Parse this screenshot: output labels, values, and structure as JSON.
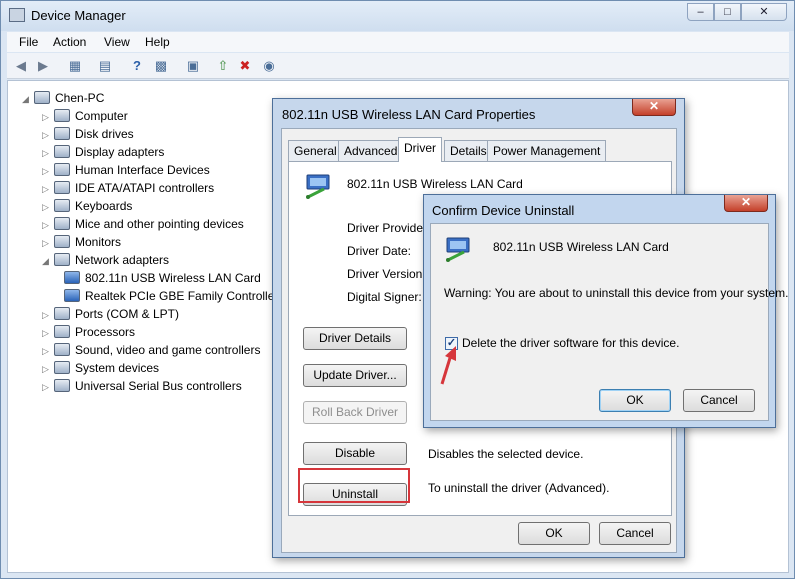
{
  "window": {
    "title": "Device Manager"
  },
  "menu": [
    "File",
    "Action",
    "View",
    "Help"
  ],
  "toolbar_icons": [
    "back-icon",
    "forward-icon",
    "show-hide-tree-icon",
    "properties-icon",
    "help-icon",
    "view-icon",
    "scan-changes-icon",
    "update-driver-icon",
    "uninstall-icon",
    "disable-icon"
  ],
  "tree": {
    "root": "Chen-PC",
    "items": [
      {
        "label": "Computer",
        "expanded": false
      },
      {
        "label": "Disk drives",
        "expanded": false
      },
      {
        "label": "Display adapters",
        "expanded": false
      },
      {
        "label": "Human Interface Devices",
        "expanded": false
      },
      {
        "label": "IDE ATA/ATAPI controllers",
        "expanded": false
      },
      {
        "label": "Keyboards",
        "expanded": false
      },
      {
        "label": "Mice and other pointing devices",
        "expanded": false
      },
      {
        "label": "Monitors",
        "expanded": false
      },
      {
        "label": "Network adapters",
        "expanded": true
      },
      {
        "label": "802.11n USB Wireless LAN Card",
        "child": true
      },
      {
        "label": "Realtek PCIe GBE Family Controlle",
        "child": true
      },
      {
        "label": "Ports (COM & LPT)",
        "expanded": false
      },
      {
        "label": "Processors",
        "expanded": false
      },
      {
        "label": "Sound, video and game controllers",
        "expanded": false
      },
      {
        "label": "System devices",
        "expanded": false
      },
      {
        "label": "Universal Serial Bus controllers",
        "expanded": false
      }
    ]
  },
  "props": {
    "title": "802.11n USB Wireless LAN Card Properties",
    "tabs": [
      "General",
      "Advanced",
      "Driver",
      "Details",
      "Power Management"
    ],
    "active_tab": "Driver",
    "device_name": "802.11n USB Wireless LAN Card",
    "fields": [
      "Driver Provider:",
      "Driver Date:",
      "Driver Version:",
      "Digital Signer:"
    ],
    "buttons": {
      "details": "Driver Details",
      "update": "Update Driver...",
      "rollback": "Roll Back Driver",
      "disable": "Disable",
      "uninstall": "Uninstall"
    },
    "disable_desc": "Disables the selected device.",
    "uninstall_desc": "To uninstall the driver (Advanced).",
    "ok": "OK",
    "cancel": "Cancel"
  },
  "confirm": {
    "title": "Confirm Device Uninstall",
    "device_name": "802.11n USB Wireless LAN Card",
    "warning": "Warning: You are about to uninstall this device from your system.",
    "checkbox_label": "Delete the driver software for this device.",
    "checkbox_checked": true,
    "ok": "OK",
    "cancel": "Cancel"
  },
  "accent": {
    "highlight": "#d6363b",
    "arrow": "#d6363b"
  }
}
